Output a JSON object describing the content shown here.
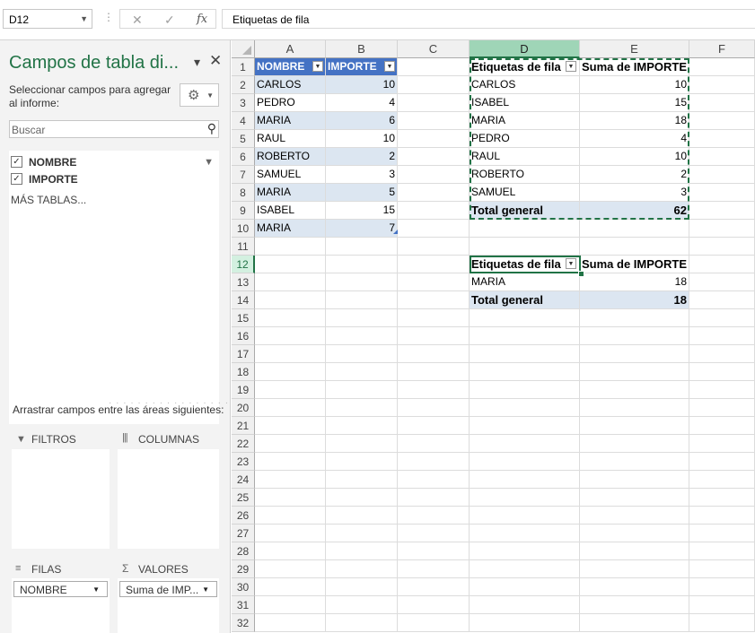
{
  "formula_bar": {
    "name_box": "D12",
    "cancel_icon": "✕",
    "enter_icon": "✓",
    "fx_label": "fx",
    "content": "Etiquetas de fila"
  },
  "pane": {
    "title": "Campos de tabla di...",
    "description": "Seleccionar campos para agregar al informe:",
    "search_placeholder": "Buscar",
    "fields": [
      {
        "label": "NOMBRE",
        "checked": true
      },
      {
        "label": "IMPORTE",
        "checked": true
      }
    ],
    "more_tables": "MÁS TABLAS...",
    "drag_text": "Arrastrar campos entre las áreas siguientes:",
    "areas": {
      "filtros": "FILTROS",
      "columnas": "COLUMNAS",
      "filas": "FILAS",
      "valores": "VALORES"
    },
    "filas_chip": "NOMBRE",
    "valores_chip": "Suma de IMP..."
  },
  "grid": {
    "columns": [
      "A",
      "B",
      "C",
      "D",
      "E",
      "F"
    ],
    "selected_column": "D",
    "selected_row": 12,
    "rows": [
      "1",
      "2",
      "3",
      "4",
      "5",
      "6",
      "7",
      "8",
      "9",
      "10",
      "11",
      "12",
      "13",
      "14",
      "15",
      "16",
      "17",
      "18",
      "19",
      "20",
      "21",
      "22",
      "23",
      "24",
      "25",
      "26",
      "27",
      "28",
      "29",
      "30",
      "31",
      "32"
    ],
    "table": {
      "headers": [
        "NOMBRE",
        "IMPORTE"
      ],
      "rows": [
        [
          "CARLOS",
          "10"
        ],
        [
          "PEDRO",
          "4"
        ],
        [
          "MARIA",
          "6"
        ],
        [
          "RAUL",
          "10"
        ],
        [
          "ROBERTO",
          "2"
        ],
        [
          "SAMUEL",
          "3"
        ],
        [
          "MARIA",
          "5"
        ],
        [
          "ISABEL",
          "15"
        ],
        [
          "MARIA",
          "7"
        ]
      ]
    },
    "pivot1": {
      "header_labels": "Etiquetas de fila",
      "header_values": "Suma de IMPORTE",
      "rows": [
        [
          "CARLOS",
          "10"
        ],
        [
          "ISABEL",
          "15"
        ],
        [
          "MARIA",
          "18"
        ],
        [
          "PEDRO",
          "4"
        ],
        [
          "RAUL",
          "10"
        ],
        [
          "ROBERTO",
          "2"
        ],
        [
          "SAMUEL",
          "3"
        ]
      ],
      "total_label": "Total general",
      "total_value": "62"
    },
    "pivot2": {
      "header_labels": "Etiquetas de fila",
      "header_values": "Suma de IMPORTE",
      "rows": [
        [
          "MARIA",
          "18"
        ]
      ],
      "total_label": "Total general",
      "total_value": "18"
    }
  }
}
